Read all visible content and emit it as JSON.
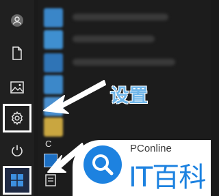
{
  "start_menu": {
    "rail": [
      {
        "icon": "user-icon"
      },
      {
        "icon": "document-icon"
      },
      {
        "icon": "pictures-icon"
      },
      {
        "icon": "gear-icon"
      },
      {
        "icon": "power-icon"
      },
      {
        "icon": "windows-logo-icon"
      }
    ],
    "app_list": {
      "section_letter": "C"
    }
  },
  "annotation": {
    "label": "设置"
  },
  "watermark": {
    "small_text": "PConline",
    "big_text": "IT百科"
  },
  "colors": {
    "rail_bg": "#202020",
    "label": "#6fb6ea",
    "watermark_blue": "#1d82e0",
    "highlight_border": "#ffffff"
  }
}
